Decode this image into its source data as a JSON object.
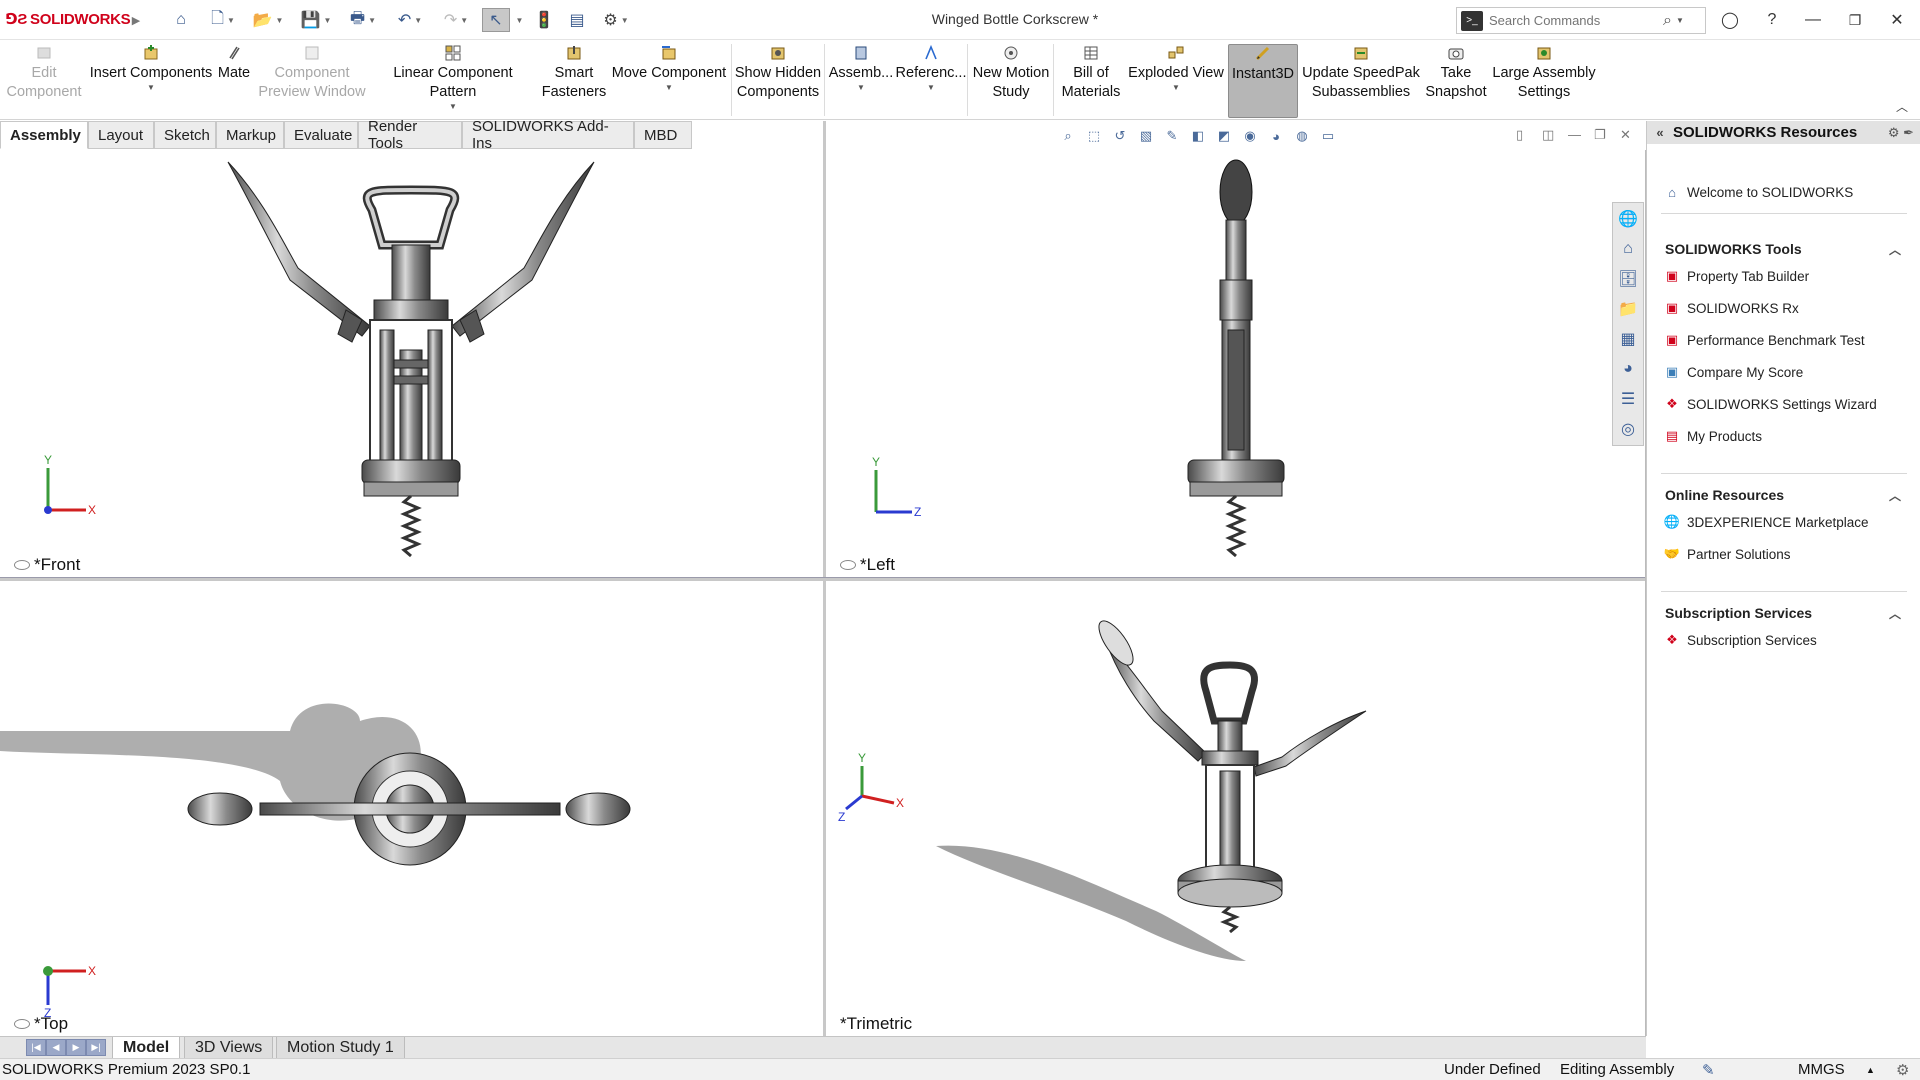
{
  "app": {
    "logo_brand": "SOLIDWORKS",
    "document_title": "Winged Bottle Corkscrew *"
  },
  "search": {
    "placeholder": "Search Commands"
  },
  "commands": [
    {
      "id": "edit-component",
      "label_l1": "Edit",
      "label_l2": "Component",
      "enabled": false
    },
    {
      "id": "insert-components",
      "label_l1": "Insert Components",
      "label_l2": "",
      "enabled": true
    },
    {
      "id": "mate",
      "label_l1": "Mate",
      "label_l2": "",
      "enabled": true
    },
    {
      "id": "component-preview-window",
      "label_l1": "Component",
      "label_l2": "Preview Window",
      "enabled": false
    },
    {
      "id": "linear-component-pattern",
      "label_l1": "Linear Component Pattern",
      "label_l2": "",
      "enabled": true
    },
    {
      "id": "smart-fasteners",
      "label_l1": "Smart",
      "label_l2": "Fasteners",
      "enabled": true
    },
    {
      "id": "move-component",
      "label_l1": "Move Component",
      "label_l2": "",
      "enabled": true
    },
    {
      "id": "show-hidden-components",
      "label_l1": "Show Hidden",
      "label_l2": "Components",
      "enabled": true
    },
    {
      "id": "assembly",
      "label_l1": "Assemb...",
      "label_l2": "",
      "enabled": true
    },
    {
      "id": "reference",
      "label_l1": "Referenc...",
      "label_l2": "",
      "enabled": true
    },
    {
      "id": "new-motion-study",
      "label_l1": "New Motion",
      "label_l2": "Study",
      "enabled": true
    },
    {
      "id": "bill-of-materials",
      "label_l1": "Bill of",
      "label_l2": "Materials",
      "enabled": true
    },
    {
      "id": "exploded-view",
      "label_l1": "Exploded View",
      "label_l2": "",
      "enabled": true
    },
    {
      "id": "instant3d",
      "label_l1": "Instant3D",
      "label_l2": "",
      "enabled": true,
      "active": true
    },
    {
      "id": "update-speedpak",
      "label_l1": "Update SpeedPak",
      "label_l2": "Subassemblies",
      "enabled": true
    },
    {
      "id": "take-snapshot",
      "label_l1": "Take",
      "label_l2": "Snapshot",
      "enabled": true
    },
    {
      "id": "large-assembly-settings",
      "label_l1": "Large Assembly",
      "label_l2": "Settings",
      "enabled": true
    }
  ],
  "cm_tabs": [
    "Assembly",
    "Layout",
    "Sketch",
    "Markup",
    "Evaluate",
    "Render Tools",
    "SOLIDWORKS Add-Ins",
    "MBD"
  ],
  "viewports": {
    "front": "*Front",
    "left": "*Left",
    "top": "*Top",
    "trimetric": "*Trimetric"
  },
  "axes": {
    "x": "X",
    "y": "Y",
    "z": "Z"
  },
  "taskpane": {
    "title": "SOLIDWORKS Resources",
    "welcome": "Welcome to SOLIDWORKS",
    "sections": [
      {
        "title": "SOLIDWORKS Tools",
        "items": [
          "Property Tab Builder",
          "SOLIDWORKS Rx",
          "Performance Benchmark Test",
          "Compare My Score",
          "SOLIDWORKS Settings Wizard",
          "My Products"
        ]
      },
      {
        "title": "Online Resources",
        "items": [
          "3DEXPERIENCE Marketplace",
          "Partner Solutions"
        ]
      },
      {
        "title": "Subscription Services",
        "items": [
          "Subscription Services"
        ]
      }
    ]
  },
  "bottom_tabs": [
    "Model",
    "3D Views",
    "Motion Study 1"
  ],
  "status": {
    "product": "SOLIDWORKS Premium 2023 SP0.1",
    "state": "Under Defined",
    "mode": "Editing Assembly",
    "units": "MMGS"
  },
  "colors": {
    "brand": "#d0021b",
    "accent": "#3c5f96",
    "active_command": "#b6b6b6"
  }
}
